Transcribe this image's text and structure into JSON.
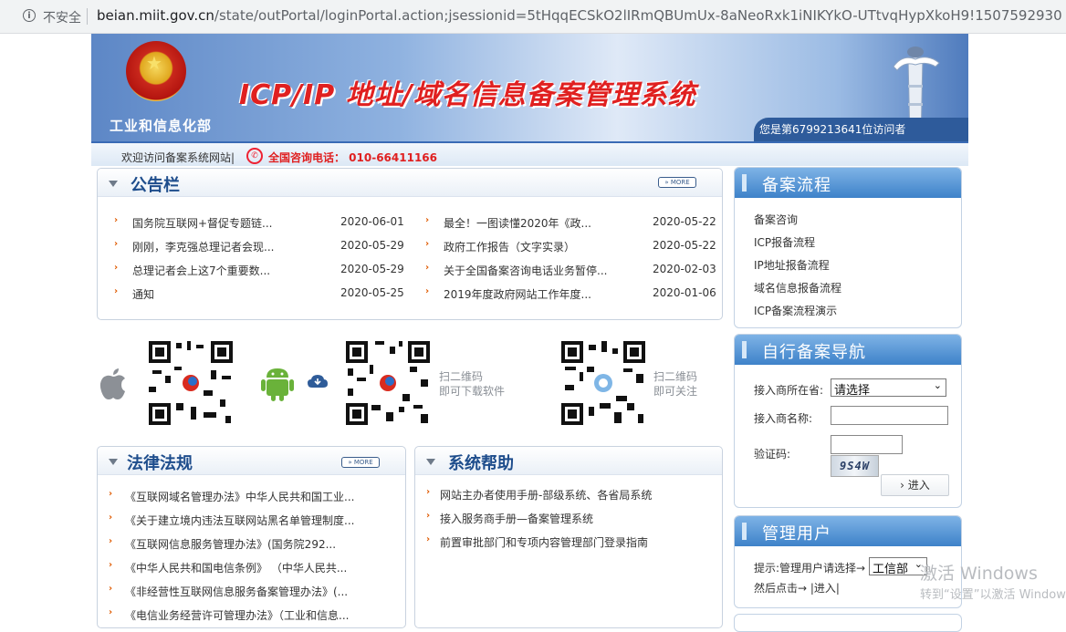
{
  "browser": {
    "security_label": "不安全",
    "url_host": "beian.miit.gov.cn",
    "url_path": "/state/outPortal/loginPortal.action;jsessionid=5tHqqECSkO2lIRmQBUmUx-8aNeoRxk1iNIKYkO-UTtvqHypXkoH9!1507592930"
  },
  "banner": {
    "ministry": "工业和信息化部",
    "title": "ICP/IP 地址/域名信息备案管理系统",
    "visitor_text": "您是第6799213641位访问者"
  },
  "welcome": {
    "text": "欢迎访问备案系统网站|",
    "hotline": "全国咨询电话：  010-66411166"
  },
  "announcements": {
    "title": "公告栏",
    "more": "MORE",
    "left": [
      {
        "text": "国务院互联网+督促专题链...",
        "date": "2020-06-01"
      },
      {
        "text": "刚刚，李克强总理记者会现...",
        "date": "2020-05-29"
      },
      {
        "text": "总理记者会上这7个重要数...",
        "date": "2020-05-29"
      },
      {
        "text": "通知",
        "date": "2020-05-25"
      }
    ],
    "right": [
      {
        "text": "最全！一图读懂2020年《政...",
        "date": "2020-05-22"
      },
      {
        "text": "政府工作报告（文字实录）",
        "date": "2020-05-22"
      },
      {
        "text": "关于全国备案咨询电话业务暂停...",
        "date": "2020-02-03"
      },
      {
        "text": "2019年度政府网站工作年度...",
        "date": "2020-01-06"
      }
    ]
  },
  "downloads": {
    "scan_download": [
      "扫二维码",
      "即可下载软件"
    ],
    "scan_follow": [
      "扫二维码",
      "即可关注"
    ]
  },
  "laws": {
    "title": "法律法规",
    "more": "MORE",
    "items": [
      "《互联网域名管理办法》中华人民共和国工业...",
      "《关于建立境内违法互联网站黑名单管理制度...",
      "《互联网信息服务管理办法》(国务院292...",
      "《中华人民共和国电信条例》 （中华人民共...",
      "《非经营性互联网信息服务备案管理办法》(...",
      "《电信业务经营许可管理办法》（工业和信息..."
    ]
  },
  "help": {
    "title": "系统帮助",
    "items": [
      "网站主办者使用手册-部级系统、各省局系统",
      "接入服务商手册—备案管理系统",
      "前置审批部门和专项内容管理部门登录指南"
    ]
  },
  "process": {
    "title": "备案流程",
    "items": [
      "备案咨询",
      "ICP报备流程",
      "IP地址报备流程",
      "域名信息报备流程",
      "ICP备案流程演示"
    ]
  },
  "self_nav": {
    "title": "自行备案导航",
    "province_label": "接入商所在省:",
    "province_value": "请选择",
    "name_label": "接入商名称:",
    "name_value": "",
    "captcha_label": "验证码:",
    "captcha_value": "",
    "captcha_image_text": "9S4W",
    "go_button": "进入"
  },
  "admin": {
    "title": "管理用户",
    "prompt": "提示:管理用户请选择→",
    "select_value": "工信部",
    "then_click": "然后点击→ |进入|"
  },
  "os_watermark": {
    "line1": "激活 Windows",
    "line2": "转到“设置”以激活 Windows。"
  }
}
